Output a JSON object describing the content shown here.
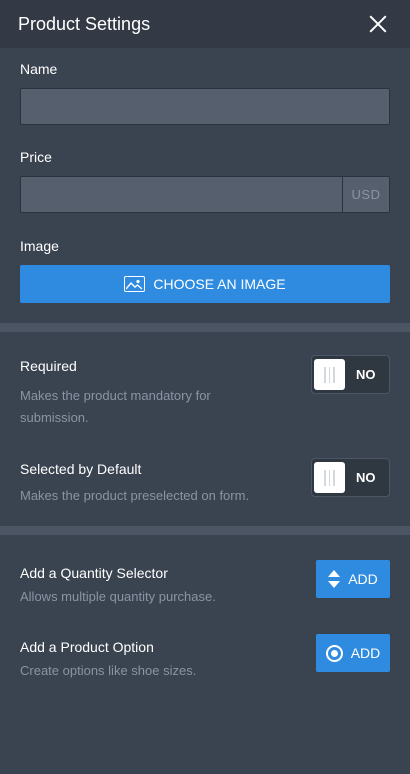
{
  "header": {
    "title": "Product Settings"
  },
  "form": {
    "name_label": "Name",
    "name_value": "",
    "price_label": "Price",
    "price_value": "",
    "price_currency": "USD",
    "image_label": "Image",
    "choose_image_label": "CHOOSE AN IMAGE"
  },
  "required": {
    "title": "Required",
    "description": "Makes the product mandatory for submission.",
    "toggle_state": "NO"
  },
  "selected_default": {
    "title": "Selected by Default",
    "description": "Makes the product preselected on form.",
    "toggle_state": "NO"
  },
  "quantity_selector": {
    "title": "Add a Quantity Selector",
    "description": "Allows multiple quantity purchase.",
    "button_label": "ADD"
  },
  "product_option": {
    "title": "Add a Product Option",
    "description": "Create options like shoe sizes.",
    "button_label": "ADD"
  },
  "colors": {
    "accent": "#2f8be0",
    "panel": "#3a4350",
    "header": "#333a45"
  },
  "icons": {
    "close": "close-icon",
    "image": "image-icon",
    "quantity": "stepper-icon",
    "option": "radio-icon"
  }
}
